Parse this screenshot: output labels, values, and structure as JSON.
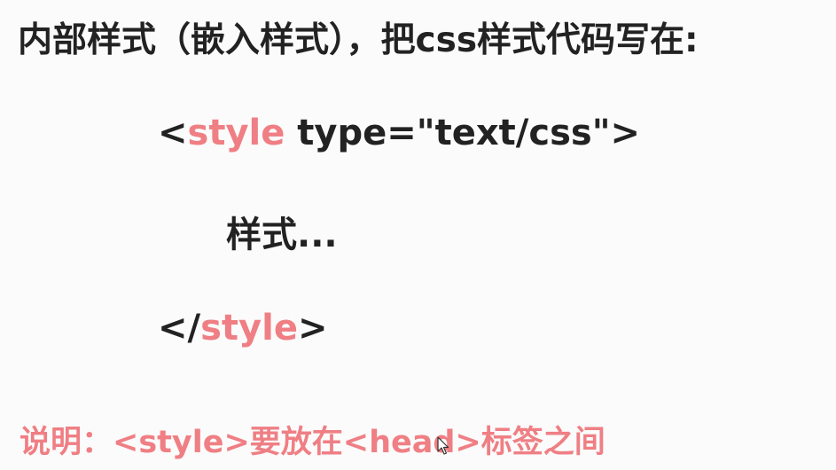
{
  "title": "内部样式（嵌入样式），把css样式代码写在:",
  "code": {
    "open_bracket": "<",
    "open_tag_name": "style",
    "open_attr": " type=\"text/css\">",
    "content": "样式...",
    "close_bracket": "</",
    "close_tag_name": "style",
    "close_end": ">"
  },
  "note": "说明：<style>要放在<head>标签之间",
  "colors": {
    "text": "#222222",
    "keyword": "#ef7f84",
    "background": "#fbfbfb"
  },
  "icons": {
    "cursor": "mouse-pointer-icon"
  }
}
